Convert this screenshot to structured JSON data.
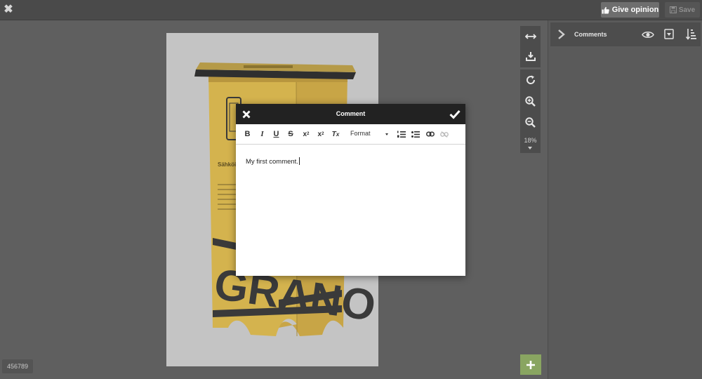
{
  "header": {
    "give_opinion_label": "Give opinion",
    "save_label": "Save"
  },
  "sidebar": {
    "title": "Comments"
  },
  "document": {
    "brand_text": "GRANO",
    "side_heading": "Sähköise"
  },
  "viewer": {
    "zoom_level": "18%",
    "document_id": "456789"
  },
  "comment_dialog": {
    "title": "Comment",
    "format_label": "Format",
    "body_text": "My first comment."
  },
  "colors": {
    "add_button": "#89a561",
    "dialog_header": "#222222",
    "stand_yellow": "#d4b34e",
    "stand_dark": "#3a3a3a"
  }
}
